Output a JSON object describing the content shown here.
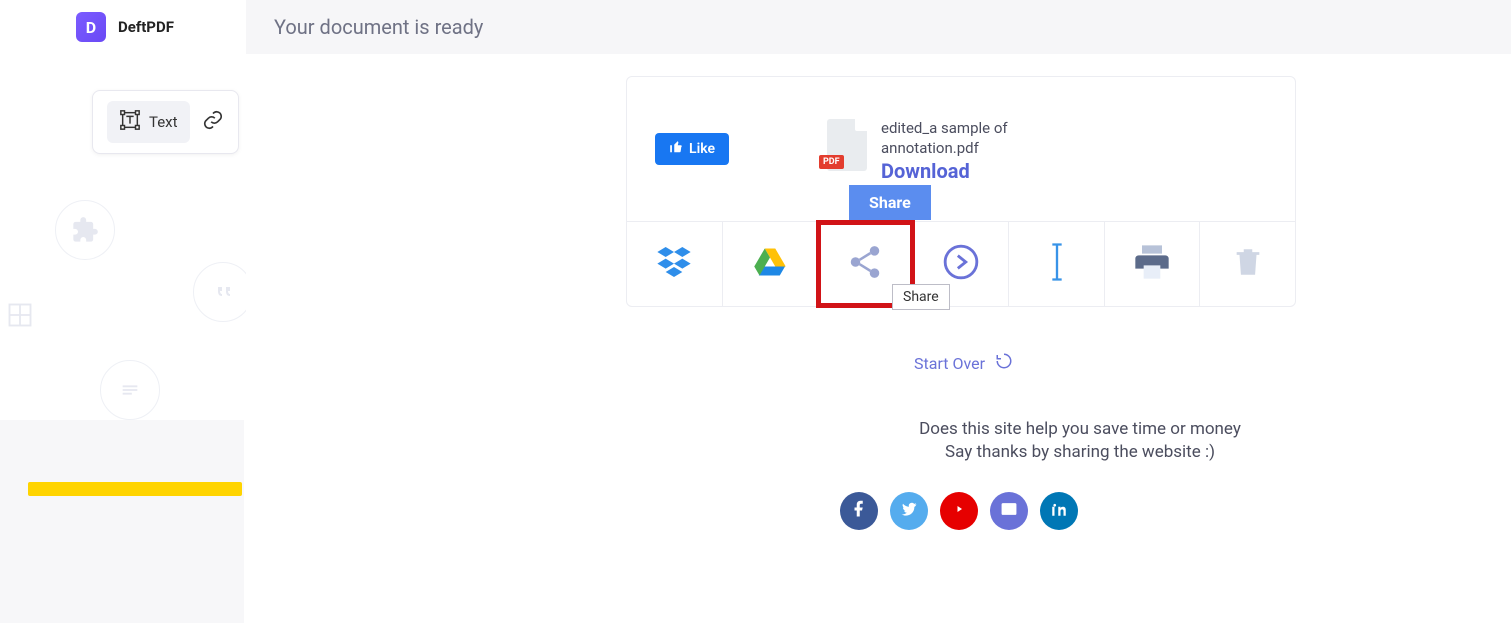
{
  "brand": {
    "logo_letter": "D",
    "name": "DeftPDF"
  },
  "sidebar": {
    "text_tool_label": "Text"
  },
  "header": {
    "title": "Your document is ready"
  },
  "like": {
    "label": "Like"
  },
  "file": {
    "badge": "PDF",
    "name_line1": "edited_a sample of",
    "name_line2": "annotation.pdf",
    "download_label": "Download"
  },
  "share_button": {
    "label": "Share"
  },
  "actions": {
    "tooltip": "Share"
  },
  "start_over": {
    "label": "Start Over"
  },
  "prompt": {
    "line1": "Does this site help you save time or money",
    "line2": "Say thanks by sharing the website :)"
  }
}
